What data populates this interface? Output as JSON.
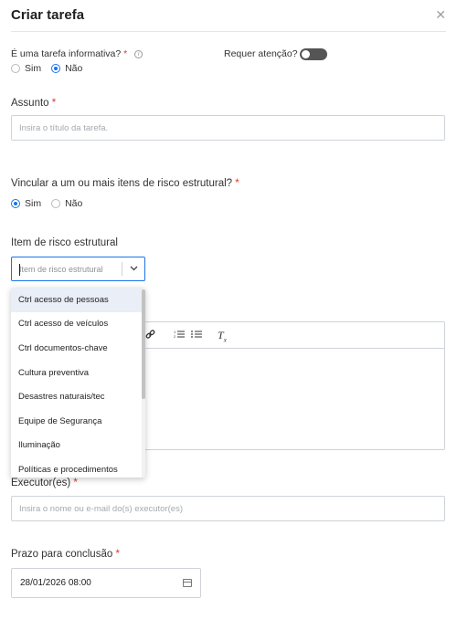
{
  "dialog": {
    "title": "Criar tarefa",
    "close_icon": "close-icon"
  },
  "informative": {
    "label": "É uma tarefa informativa?",
    "required_mark": "*",
    "info_icon": "info-icon",
    "options": [
      "Sim",
      "Não"
    ],
    "selected": "Não"
  },
  "attention": {
    "label": "Requer atenção?",
    "enabled": false
  },
  "subject": {
    "label": "Assunto",
    "required_mark": "*",
    "placeholder": "Insira o título da tarefa."
  },
  "link_risk": {
    "label": "Vincular a um ou mais itens de risco estrutural?",
    "required_mark": "*",
    "options": [
      "Sim",
      "Não"
    ],
    "selected": "Sim"
  },
  "risk_item": {
    "label": "Item de risco estrutural",
    "placeholder": "Item de risco estrutural",
    "chevron_icon": "chevron-down-icon",
    "options": [
      "Ctrl acesso de pessoas",
      "Ctrl acesso de veículos",
      "Ctrl documentos-chave",
      "Cultura preventiva",
      "Desastres naturais/tec",
      "Equipe de Segurança",
      "Iluminação",
      "Políticas e procedimentos"
    ],
    "highlighted": "Ctrl acesso de pessoas"
  },
  "editor": {
    "toolbar": {
      "link_icon": "link-icon",
      "ordered_list_icon": "ordered-list-icon",
      "bullet_list_icon": "bullet-list-icon",
      "clear_format_icon": "clear-format-icon"
    }
  },
  "executors": {
    "label": "Executor(es)",
    "required_mark": "*",
    "placeholder": "Insira o nome ou e-mail do(s) executor(es)"
  },
  "deadline": {
    "label": "Prazo para conclusão",
    "required_mark": "*",
    "value": "28/01/2026 08:00",
    "calendar_icon": "calendar-icon"
  },
  "colors": {
    "accent": "#1a73e8",
    "required": "#e0362c",
    "toggle_off": "#555555",
    "highlight": "#e9eef7"
  }
}
